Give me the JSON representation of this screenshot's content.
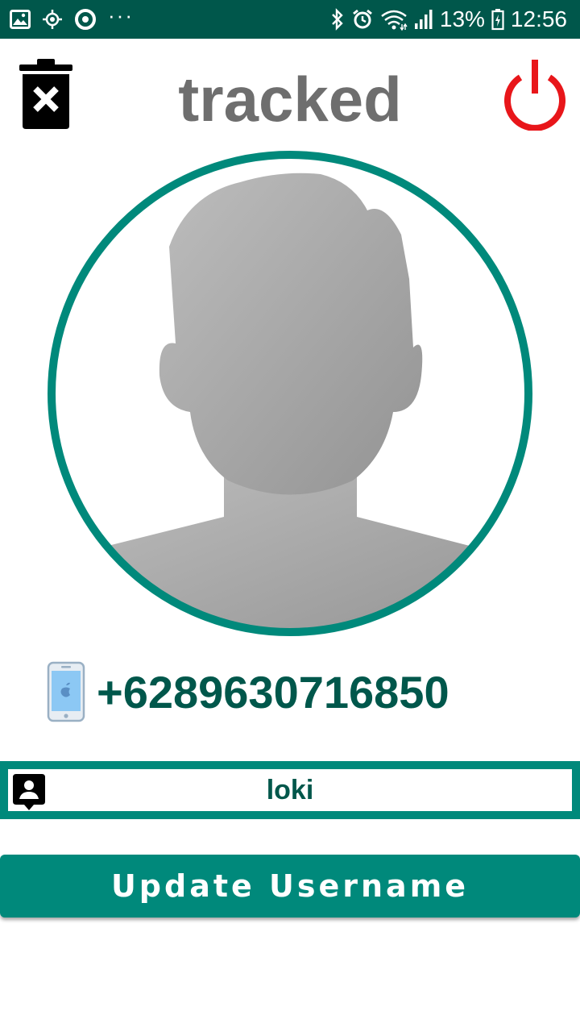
{
  "status_bar": {
    "left_icons": [
      "gallery-icon",
      "location-icon",
      "app-icon",
      "more-dots-icon"
    ],
    "more_dots": "···",
    "right_icons": [
      "bluetooth-icon",
      "alarm-icon",
      "wifi-icon",
      "signal-icon",
      "battery-icon"
    ],
    "battery_percent": "13%",
    "time": "12:56"
  },
  "header": {
    "title": "tracked",
    "delete_icon": "trash-icon",
    "power_icon": "power-icon"
  },
  "profile": {
    "avatar_icon": "person-silhouette-icon"
  },
  "phone": {
    "icon": "phone-icon",
    "number": "+6289630716850"
  },
  "username": {
    "icon": "contact-icon",
    "value": "loki"
  },
  "actions": {
    "update_label": "Update Username"
  },
  "colors": {
    "primary": "#00897b",
    "primary_dark": "#00574b",
    "power_red": "#e8161a",
    "title_gray": "#6e6e6e"
  }
}
